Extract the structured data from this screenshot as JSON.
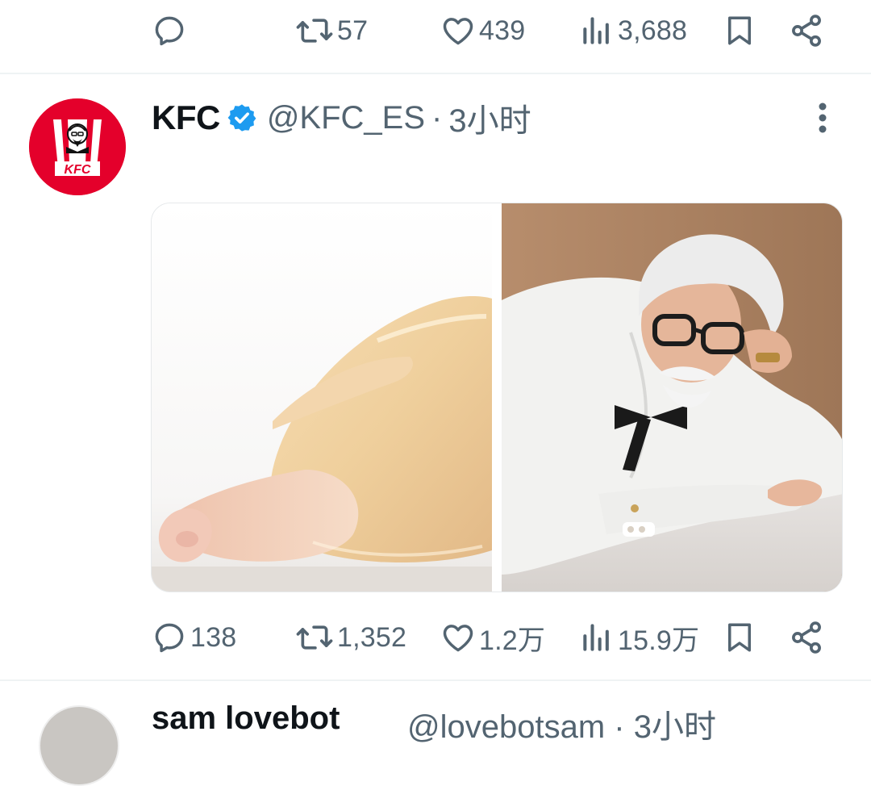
{
  "prev_tweet": {
    "actions": {
      "replies": "",
      "retweets": "57",
      "likes": "439",
      "views": "3,688"
    }
  },
  "tweet": {
    "author_name": "KFC",
    "handle": "@KFC_ES",
    "separator": "·",
    "time": "3小时",
    "avatar_logo_text": "KFC",
    "actions": {
      "replies": "138",
      "retweets": "1,352",
      "likes": "1.2万",
      "views": "15.9万"
    }
  },
  "next_tweet": {
    "author_name": "sam lovebot",
    "handle": "@lovebotsam · 3小时"
  },
  "colors": {
    "text_secondary": "#536471",
    "verified_blue": "#1d9bf0",
    "kfc_red": "#e4002b",
    "divider": "#eff3f4"
  },
  "icons": [
    "reply-icon",
    "retweet-icon",
    "like-icon",
    "views-icon",
    "bookmark-icon",
    "share-icon",
    "verified-badge-icon",
    "more-options-icon"
  ]
}
